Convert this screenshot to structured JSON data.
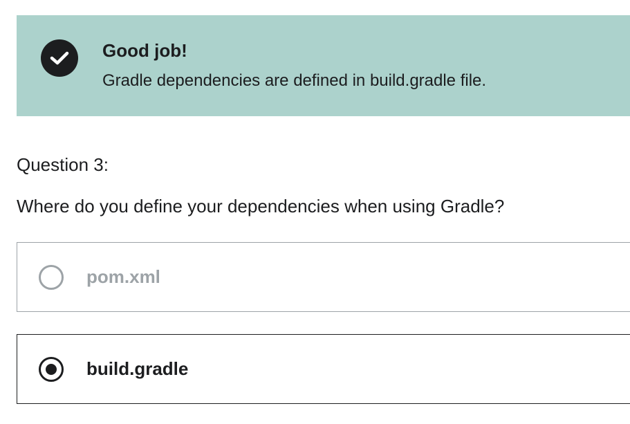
{
  "feedback": {
    "title": "Good job!",
    "message": "Gradle dependencies are defined in build.gradle file.",
    "icon": "check-circle-icon",
    "background_color": "#acd2cc"
  },
  "question": {
    "number_label": "Question 3:",
    "text": "Where do you define your dependencies when using Gradle?"
  },
  "options": [
    {
      "label": "pom.xml",
      "selected": false,
      "state": "disabled"
    },
    {
      "label": "build.gradle",
      "selected": true,
      "state": "selected"
    }
  ]
}
